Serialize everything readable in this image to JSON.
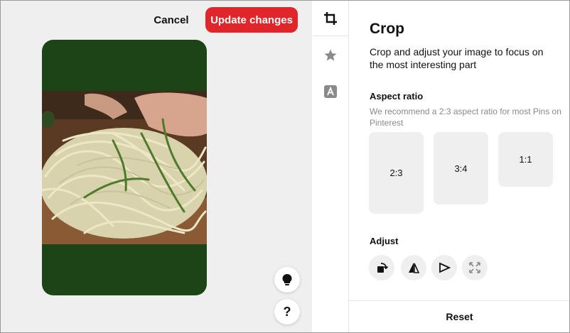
{
  "header": {
    "cancel_label": "Cancel",
    "update_label": "Update changes"
  },
  "colors": {
    "accent": "#e0262b",
    "pin_background": "#1d4416",
    "canvas_background": "#efefef"
  },
  "preview": {
    "image_subject": "spiralized zucchini noodles on a cutting board"
  },
  "floating_buttons": {
    "idea_icon": "lightbulb-icon",
    "help_label": "?"
  },
  "rail": {
    "items": [
      {
        "icon": "crop-icon",
        "active": true
      },
      {
        "icon": "star-icon",
        "active": false
      },
      {
        "icon": "text-icon",
        "active": false
      }
    ]
  },
  "panel": {
    "title": "Crop",
    "description": "Crop and adjust your image to focus on the most interesting part",
    "aspect_label": "Aspect ratio",
    "aspect_hint": "We recommend a 2:3 aspect ratio for most Pins on Pinterest",
    "ratios": [
      "2:3",
      "3:4",
      "1:1"
    ],
    "adjust_label": "Adjust",
    "adjust_tools": [
      "rotate-icon",
      "flip-horizontal-icon",
      "flip-vertical-icon",
      "expand-icon"
    ],
    "reset_label": "Reset"
  }
}
